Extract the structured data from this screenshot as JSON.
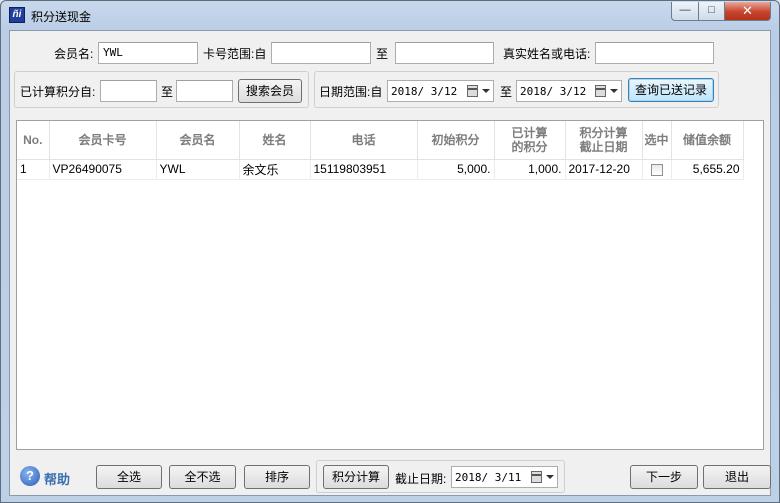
{
  "window": {
    "title": "积分送现金",
    "icon_text": "ñi"
  },
  "search": {
    "member_name_label": "会员名:",
    "member_name_value": "YWL",
    "card_range_label": "卡号范围:自",
    "card_to_label": "至",
    "real_name_phone_label": "真实姓名或电话:",
    "points_from_label": "已计算积分自:",
    "points_to_label": "至",
    "search_button": "搜索会员",
    "date_range_label": "日期范围:自",
    "date_from": "2018/ 3/12",
    "date_to_label": "至",
    "date_to": "2018/ 3/12",
    "query_sent_button": "查询已送记录"
  },
  "table": {
    "headers": [
      "No.",
      "会员卡号",
      "会员名",
      "姓名",
      "电话",
      "初始积分",
      "已计算的积分",
      "积分计算截止日期",
      "选中",
      "储值余额"
    ],
    "header_lines": [
      [
        "No."
      ],
      [
        "会员卡号"
      ],
      [
        "会员名"
      ],
      [
        "姓名"
      ],
      [
        "电话"
      ],
      [
        "初始积分"
      ],
      [
        "已计算",
        "的积分"
      ],
      [
        "积分计算",
        "截止日期"
      ],
      [
        "选中"
      ],
      [
        "储值余额"
      ]
    ],
    "rows": [
      {
        "no": "1",
        "card": "VP26490075",
        "member": "YWL",
        "name": "余文乐",
        "phone": "15119803951",
        "initial_points": "5,000.",
        "calculated_points": "1,000.",
        "cutoff_date": "2017-12-20",
        "selected": false,
        "balance": "5,655.20"
      }
    ]
  },
  "footer": {
    "help_label": "帮助",
    "select_all": "全选",
    "select_none": "全不选",
    "sort": "排序",
    "calc_points": "积分计算",
    "cutoff_label": "截止日期:",
    "cutoff_date": "2018/ 3/11",
    "next": "下一步",
    "exit": "退出"
  }
}
